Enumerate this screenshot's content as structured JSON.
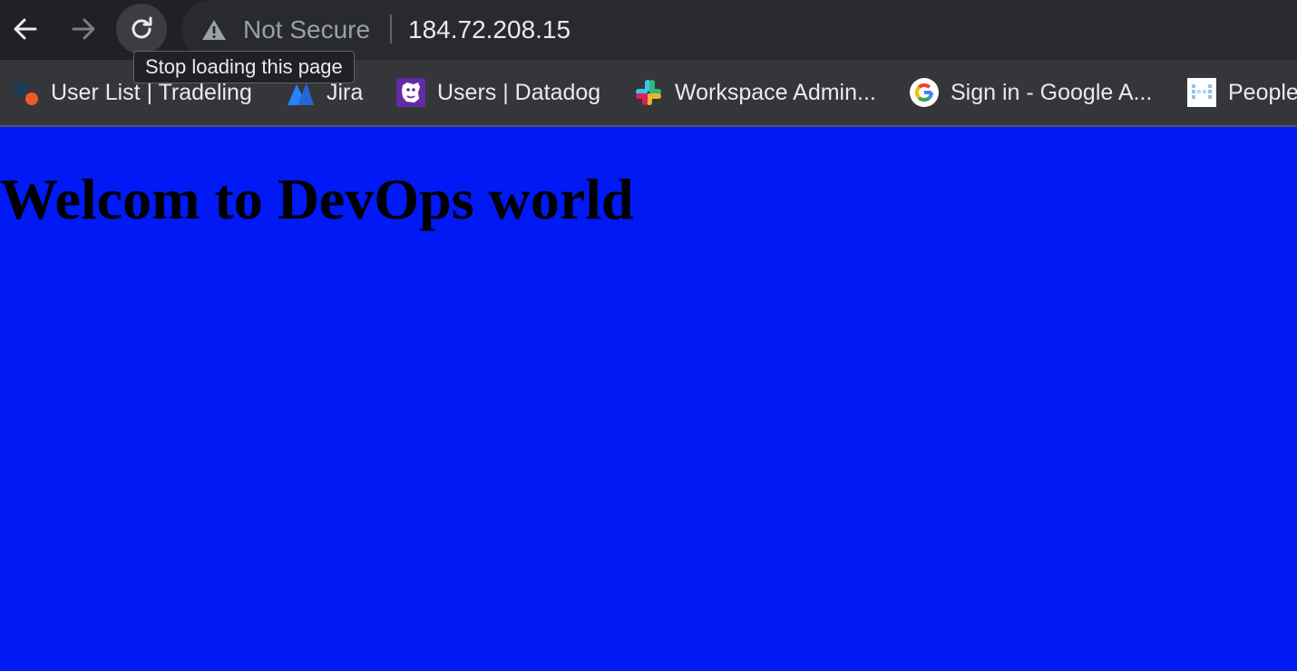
{
  "toolbar": {
    "back_icon": "arrow-left-icon",
    "forward_icon": "arrow-right-icon",
    "reload_icon": "reload-icon",
    "reload_tooltip": "Stop loading this page"
  },
  "omnibox": {
    "security_icon": "warning-triangle-icon",
    "security_label": "Not Secure",
    "url": "184.72.208.15"
  },
  "bookmarks": [
    {
      "label": "User List | Tradeling",
      "icon": "tradeling-icon"
    },
    {
      "label": "Jira",
      "icon": "jira-icon"
    },
    {
      "label": "Users | Datadog",
      "icon": "datadog-icon"
    },
    {
      "label": "Workspace Admin...",
      "icon": "slack-icon"
    },
    {
      "label": "Sign in - Google A...",
      "icon": "google-icon"
    },
    {
      "label": "People",
      "icon": "people-icon"
    }
  ],
  "page": {
    "heading": "Welcom to DevOps world",
    "background_color": "#0019f5"
  },
  "colors": {
    "toolbar_bg": "#202124",
    "bookmarks_bg": "#35363a",
    "text_light": "#e8eaed",
    "text_muted": "#9aa0a6"
  }
}
